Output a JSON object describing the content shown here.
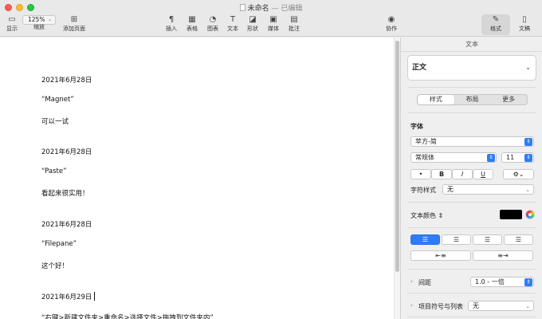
{
  "window": {
    "title": "未命名",
    "subtitle": "— 已编辑"
  },
  "toolbar": {
    "zoom_value": "125%",
    "left_items": [
      {
        "label": "显示",
        "icon": "sidebar-icon"
      },
      {
        "label": "缩放",
        "icon": "zoom-icon"
      },
      {
        "label": "添加页面",
        "icon": "add-page-icon"
      }
    ],
    "items": [
      {
        "label": "插入",
        "icon": "paragraph-icon",
        "glyph": "¶"
      },
      {
        "label": "表格",
        "icon": "table-icon",
        "glyph": "▦"
      },
      {
        "label": "图表",
        "icon": "chart-icon",
        "glyph": "◔"
      },
      {
        "label": "文本",
        "icon": "text-icon",
        "glyph": "T"
      },
      {
        "label": "形状",
        "icon": "shape-icon",
        "glyph": "◪"
      },
      {
        "label": "媒体",
        "icon": "media-icon",
        "glyph": "▣"
      },
      {
        "label": "批注",
        "icon": "comment-icon",
        "glyph": "▤"
      }
    ],
    "collab_label": "协作",
    "format_label": "格式",
    "document_label": "文稿"
  },
  "document": {
    "lines": [
      "2021年6月28日",
      "“Magnet”",
      "可以一试",
      "2021年6月28日",
      "“Paste”",
      "看起来很实用！",
      "2021年6月28日",
      "“Filepane”",
      "这个好！",
      "2021年6月29日",
      "“右键>新建文件夹>重命名>选择文件>拖拽到文件夹内”"
    ]
  },
  "sidebar": {
    "header": "文本",
    "paragraph_style": "正文",
    "tabs": [
      "样式",
      "布局",
      "更多"
    ],
    "active_tab": 0,
    "font_section_label": "字体",
    "font_family": "苹方-简",
    "font_weight": "常规体",
    "font_size": "11",
    "style_buttons": [
      "•",
      "B",
      "I",
      "U"
    ],
    "char_style_label": "字符样式",
    "char_style_value": "无",
    "text_color_label": "文本颜色",
    "text_color": "#000000",
    "accent_color": "#2f7df6",
    "spacing_label": "间距",
    "spacing_value": "1.0 - 一倍",
    "bullets_label": "项目符号与列表",
    "bullets_value": "无"
  }
}
